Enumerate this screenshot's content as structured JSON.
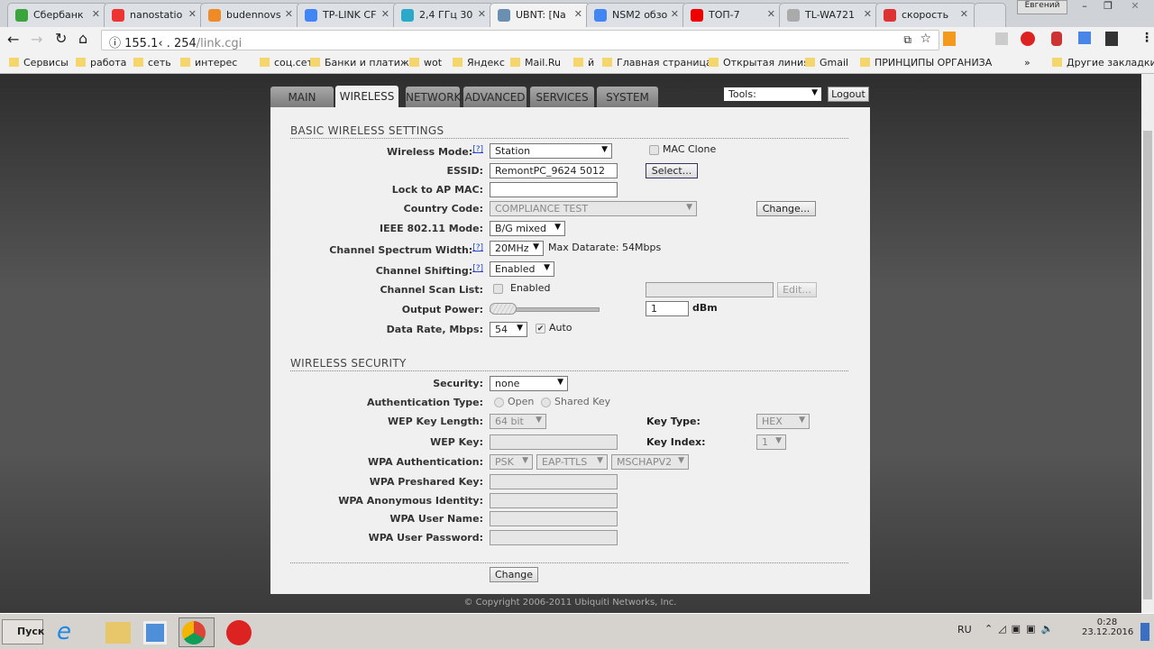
{
  "browser": {
    "tabs": [
      {
        "title": "Сбербанк",
        "color": "#3aa53a"
      },
      {
        "title": "nanostatio",
        "color": "#e33"
      },
      {
        "title": "budennovs",
        "color": "#f08a24"
      },
      {
        "title": "TP-LINK CF",
        "color": "#4285f4"
      },
      {
        "title": "2,4 ГГц 30",
        "color": "#2aa9c9"
      },
      {
        "title": "UBNT: [Na",
        "color": "#6a8fb0",
        "active": true
      },
      {
        "title": "NSM2 обзо",
        "color": "#4285f4"
      },
      {
        "title": "ТОП-7",
        "color": "#e00"
      },
      {
        "title": "TL-WA721",
        "color": "#aaa"
      },
      {
        "title": "скорость",
        "color": "#d33"
      }
    ],
    "profile": "Евгений",
    "url_host": "155.1‹   .   254",
    "url_path": "/link.cgi",
    "bookmarks": [
      "Сервисы",
      "работа",
      "сеть",
      "интерес",
      "соц.сети",
      "Банки и платижи",
      "wot",
      "Яндекс",
      "Mail.Ru",
      "й",
      "Главная страница",
      "Открытая линия",
      "Gmail",
      "ПРИНЦИПЫ ОРГАНИЗА"
    ],
    "other_bookmarks": "Другие закладки",
    "overflow": "»"
  },
  "nav": {
    "tabs": [
      "MAIN",
      "WIRELESS",
      "NETWORK",
      "ADVANCED",
      "SERVICES",
      "SYSTEM"
    ],
    "active": "WIRELESS",
    "tools": "Tools:",
    "logout": "Logout"
  },
  "basic": {
    "title": "BASIC WIRELESS SETTINGS",
    "help": "[?]",
    "wireless_mode_label": "Wireless Mode:",
    "wireless_mode": "Station",
    "mac_clone": "MAC Clone",
    "essid_label": "ESSID:",
    "essid": "RemontPC_9624   5012",
    "select": "Select...",
    "lock_label": "Lock to AP MAC:",
    "lock": "",
    "country_label": "Country Code:",
    "country": "COMPLIANCE TEST",
    "change": "Change...",
    "ieee_label": "IEEE 802.11 Mode:",
    "ieee": "B/G mixed",
    "width_label": "Channel Spectrum Width:",
    "width": "20MHz",
    "max_rate": "Max Datarate: 54Mbps",
    "shift_label": "Channel Shifting:",
    "shift": "Enabled",
    "scan_label": "Channel Scan List:",
    "scan_enabled": "Enabled",
    "edit": "Edit...",
    "power_label": "Output Power:",
    "power": "1",
    "power_unit": "dBm",
    "power_fraction": 0.0,
    "rate_label": "Data Rate, Mbps:",
    "rate": "54",
    "auto": "Auto"
  },
  "security": {
    "title": "WIRELESS SECURITY",
    "security_label": "Security:",
    "security": "none",
    "auth_label": "Authentication Type:",
    "open": "Open",
    "shared": "Shared Key",
    "wep_len_label": "WEP Key Length:",
    "wep_len": "64 bit",
    "key_type_label": "Key Type:",
    "key_type": "HEX",
    "wep_key_label": "WEP Key:",
    "key_index_label": "Key Index:",
    "key_index": "1",
    "wpa_auth_label": "WPA Authentication:",
    "wpa_auth": [
      "PSK",
      "EAP-TTLS",
      "MSCHAPV2"
    ],
    "psk_label": "WPA Preshared Key:",
    "anon_label": "WPA Anonymous Identity:",
    "user_label": "WPA User Name:",
    "pass_label": "WPA User Password:",
    "change": "Change"
  },
  "footer": "© Copyright 2006-2011 Ubiquiti Networks, Inc.",
  "taskbar": {
    "start": "Пуск",
    "lang": "RU",
    "time": "0:28",
    "date": "23.12.2016"
  }
}
